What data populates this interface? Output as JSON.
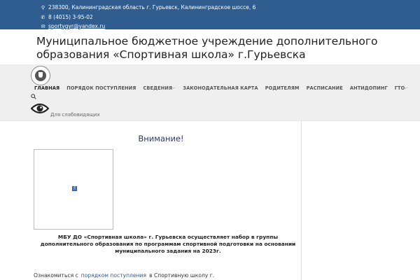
{
  "contacts": {
    "address": "238300, Калининградская область г. Гурьевск, Калининградское шоссе, 6",
    "phone": "8 (4015) 3-95-02",
    "email": "sportygyr@yandex.ru"
  },
  "site_title": "Муниципальное бюджетное учреждение дополнительного образования «Спортивная школа» г.Гурьевска",
  "menu": [
    "ГЛАВНАЯ",
    "ПОРЯДОК ПОСТУПЛЕНИЯ",
    "СВЕДЕНИЯ",
    "ЗАКОНОДАТЕЛЬНАЯ КАРТА",
    "РОДИТЕЛЯМ",
    "РАСПИСАНИЕ",
    "АНТИДОПИНГ",
    "ГТО"
  ],
  "vision_label": "Для слабовидящих",
  "notice_title": "Внимание!",
  "notice_text": "МБУ ДО «Спортивная школа» г. Гурьевска осуществляет набор в группы дополнительного образования по программам спортивной подготовки на основании муниципального задания на 2023г.",
  "bottom": {
    "prefix": "Ознакомиться с",
    "link": "порядком поступления",
    "suffix": "в Спортивную школу г."
  },
  "colors": {
    "topbar": "#2f5d8f",
    "nav_bg": "#efefef",
    "heading": "#2b3a6b"
  }
}
